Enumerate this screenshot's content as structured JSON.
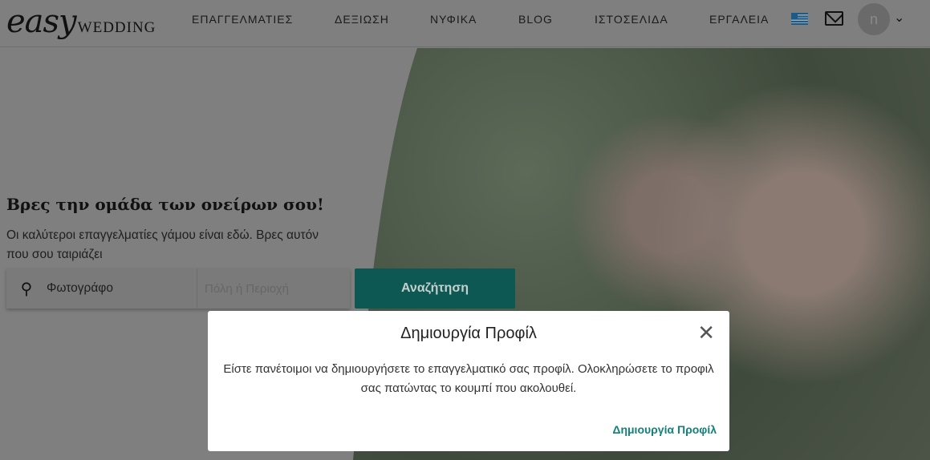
{
  "header": {
    "logo_script": "easy",
    "logo_word": "WEDDING",
    "nav": [
      "ΕΠΑΓΓΕΛΜΑΤΙΕΣ",
      "ΔΕΞΙΩΣΗ",
      "ΝΥΦΙΚΑ",
      "BLOG",
      "ΙΣΤΟΣΕΛΙΔΑ",
      "ΕΡΓΑΛΕΙΑ"
    ],
    "avatar_initial": "n",
    "language": "greek-flag-icon"
  },
  "hero": {
    "title": "Βρες την ομάδα των ονείρων σου!",
    "subtitle": "Οι καλύτεροι επαγγελματίες γάμου είναι εδώ. Βρες αυτόν που σου ταιριάζει",
    "search_value": "Φωτογράφο",
    "location_placeholder": "Πόλη ή Περιοχή",
    "search_button": "Αναζήτηση"
  },
  "modal": {
    "title": "Δημιουργία Προφίλ",
    "body": "Είστε πανέτοιμοι να δημιουργήσετε το επαγγελματικό σας προφίλ. Ολοκληρώσετε το προφιλ σας πατώντας το κουμπί που ακολουθεί.",
    "action": "Δημιουργία Προφίλ",
    "close": "✕"
  },
  "colors": {
    "accent": "#138079",
    "overlay": "#7f7f7f"
  }
}
